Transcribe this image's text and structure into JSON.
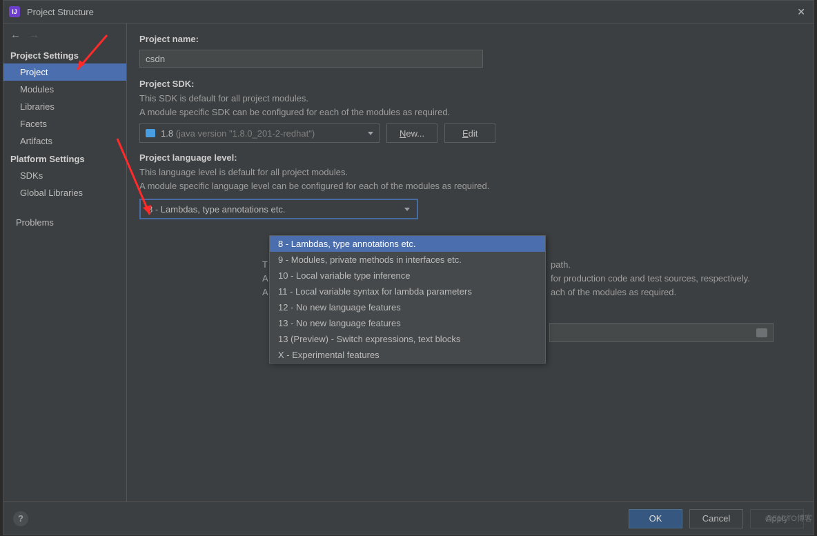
{
  "window": {
    "title": "Project Structure"
  },
  "sidebar": {
    "groups": [
      {
        "header": "Project Settings",
        "items": [
          "Project",
          "Modules",
          "Libraries",
          "Facets",
          "Artifacts"
        ],
        "selected": 0
      },
      {
        "header": "Platform Settings",
        "items": [
          "SDKs",
          "Global Libraries"
        ]
      },
      {
        "header": "",
        "items": [
          "Problems"
        ]
      }
    ]
  },
  "main": {
    "projectNameLabel": "Project name:",
    "projectNameValue": "csdn",
    "sdkLabel": "Project SDK:",
    "sdkHelp1": "This SDK is default for all project modules.",
    "sdkHelp2": "A module specific SDK can be configured for each of the modules as required.",
    "sdkSelectedShort": "1.8",
    "sdkSelectedDim": "(java version \"1.8.0_201-2-redhat\")",
    "newBtn": "New...",
    "editBtn": "Edit",
    "langLevelLabel": "Project language level:",
    "langHelp1": "This language level is default for all project modules.",
    "langHelp2": "A module specific language level can be configured for each of the modules as required.",
    "langSelected": "8 - Lambdas, type annotations etc.",
    "langOptions": [
      "8 - Lambdas, type annotations etc.",
      "9 - Modules, private methods in interfaces etc.",
      "10 - Local variable type inference",
      "11 - Local variable syntax for lambda parameters",
      "12 - No new language features",
      "13 - No new language features",
      "13 (Preview) - Switch expressions, text blocks",
      "X - Experimental features"
    ],
    "compilerFragments": {
      "l1": "path.",
      "l2": "for production code and test sources, respectively.",
      "l3": "ach of the modules as required."
    }
  },
  "footer": {
    "ok": "OK",
    "cancel": "Cancel",
    "apply": "Apply"
  },
  "watermark": "@51CTO博客"
}
